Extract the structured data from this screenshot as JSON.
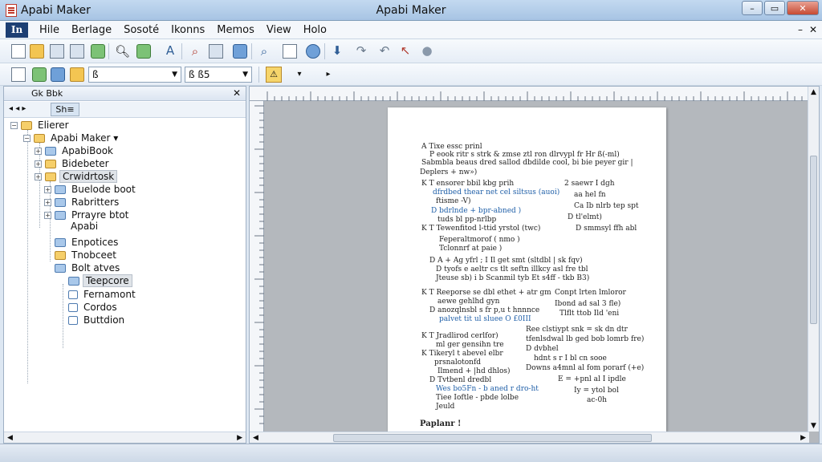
{
  "window": {
    "title_left": "Apabi Maker",
    "title_center": "Apabi Maker",
    "controls": [
      "–",
      "▭",
      "✕"
    ]
  },
  "menubar": {
    "logo": "In",
    "items": [
      "Hile",
      "Berlage",
      "Sosoté",
      "Ikonns",
      "Memos",
      "View",
      "Holo"
    ],
    "mdi": [
      "–",
      "✕"
    ]
  },
  "toolbar2": {
    "combo1_value": "ß",
    "combo2_value": "ß ß5",
    "highlight_icon": "⚠",
    "arrow_down": "▾",
    "arrow_right": "▸"
  },
  "panel": {
    "header_label": "Gk   Bbk",
    "sub_button": "Sh≡",
    "close": "✕",
    "nav": "◂  ◂   ▸",
    "tree": [
      {
        "label": "Elierer",
        "icon": "yellow",
        "expander": "−"
      },
      {
        "label": "Apabi Maker ▾",
        "icon": "yellow",
        "expander": "−"
      },
      {
        "label": "ApabiBook",
        "icon": "blue",
        "expander": "+"
      },
      {
        "label": "Bidebeter",
        "icon": "yellow",
        "expander": "+"
      },
      {
        "label": "Crwidrtosk",
        "icon": "yellow",
        "expander": "+"
      },
      {
        "label": "Buelode boot",
        "icon": "blue",
        "expander": "+"
      },
      {
        "label": "Rabritters",
        "icon": "blue",
        "expander": "+"
      },
      {
        "label": "Prrayre btot",
        "icon": "blue",
        "expander": "+"
      },
      {
        "label": "Apabi",
        "icon": "none",
        "expander": ""
      },
      {
        "label": "Enpotices",
        "icon": "blue",
        "expander": ""
      },
      {
        "label": "Tnobceet",
        "icon": "yellow",
        "expander": ""
      },
      {
        "label": "Bolt atves",
        "icon": "blue",
        "expander": ""
      },
      {
        "label": "Teepcore",
        "icon": "blue",
        "expander": ""
      },
      {
        "label": "Fernamont",
        "icon": "doc",
        "expander": ""
      },
      {
        "label": "Cordos",
        "icon": "doc",
        "expander": ""
      },
      {
        "label": "Buttdion",
        "icon": "doc",
        "expander": ""
      }
    ]
  },
  "document": {
    "lines": [
      "A  Tixe  essc  prinl",
      "P  eook  ritr  s  strk  &  zmse  ztl  ron  dlrvypl  fr  Hr  ß(-ml)",
      "Sabmbla  beaus  dred  sallod  dbdilde  cool,  bi  bie  peyer  gir  |",
      "Deplers  + nw»)",
      "K  T  ensorer  bbil  kbg  prih",
      "dfrdbed  thear  net  cel  siltsus  (auoi)",
      "ftisme  -V)",
      "D  bdrlnde  + bpr-abned )",
      "tuds  bl  pp-nrlbp",
      "K  T  Tewenfitod  l-ttid  yrstol  (twc)",
      "Feperaltmorof  (  nmo  )",
      "Tclonnrf  at  paie  )",
      "D  A  + Ag  yfrl  ;  I  Il  get  smt  (sltdbl  |  sk  fqv)",
      "D  tyofs  e  aeltr  cs  tlt  seftn  illkcy  asl  fre  tbl",
      "Jteuse  sb)  i  b  Scanmil  tyb  Et  s4ff  - tkb  B3)",
      "K  T  Reeporse  se  dbl  ethet  + atr  gm",
      "aewe  gehlhd  gyn",
      "D  anozqlnsbl  s  fr  p,u  t  hnnnce",
      "palvet  tit  ul  sluee  O  £0III",
      "K  T  Jradlirod  cerlfor)",
      "ml  ger  gensihn  tre",
      "K  Tikeryl  t  abevel  elbr",
      "prsnalotonfd",
      "Ilmend  +  |hd  dhlos)",
      "D  Tvtbenl  dredbl",
      "Wes  bo5Fn  -  b  aned  r  dro-ht",
      "Tiee  Ioftle  -  pbde  lolbe",
      "Jeuld",
      "Paplanr  !",
      "2  saewr  I  dgh",
      "aa  hel  fn",
      "Ca  Ib  nlrb  tep  spt",
      "D  tl'elmt)",
      "D  smmsyl  ffh  abl",
      "Conpt  lrten  lmloror",
      "Ibond  ad  sal  3  fle)",
      "Tlflt  ttob  Ild  'eni",
      "Ree  clstiypt  snk  =  sk  dn  dtr",
      "tfenlsdwal  lb  ged  bob  lomrb  fre)",
      "D  dvbhel",
      "hdnt  s  r  I  bl  cn  sooe",
      "Downs  a4mnl  al  fom  porarf  (+e)",
      "E  = +pnl  al  I  ipdle",
      "Iy  =  ytol  bol",
      "ac-0h"
    ]
  },
  "colors": {
    "accent": "#1d3f73",
    "link_blue": "#1f5fa8",
    "highlight_yellow": "#f6d56b"
  }
}
